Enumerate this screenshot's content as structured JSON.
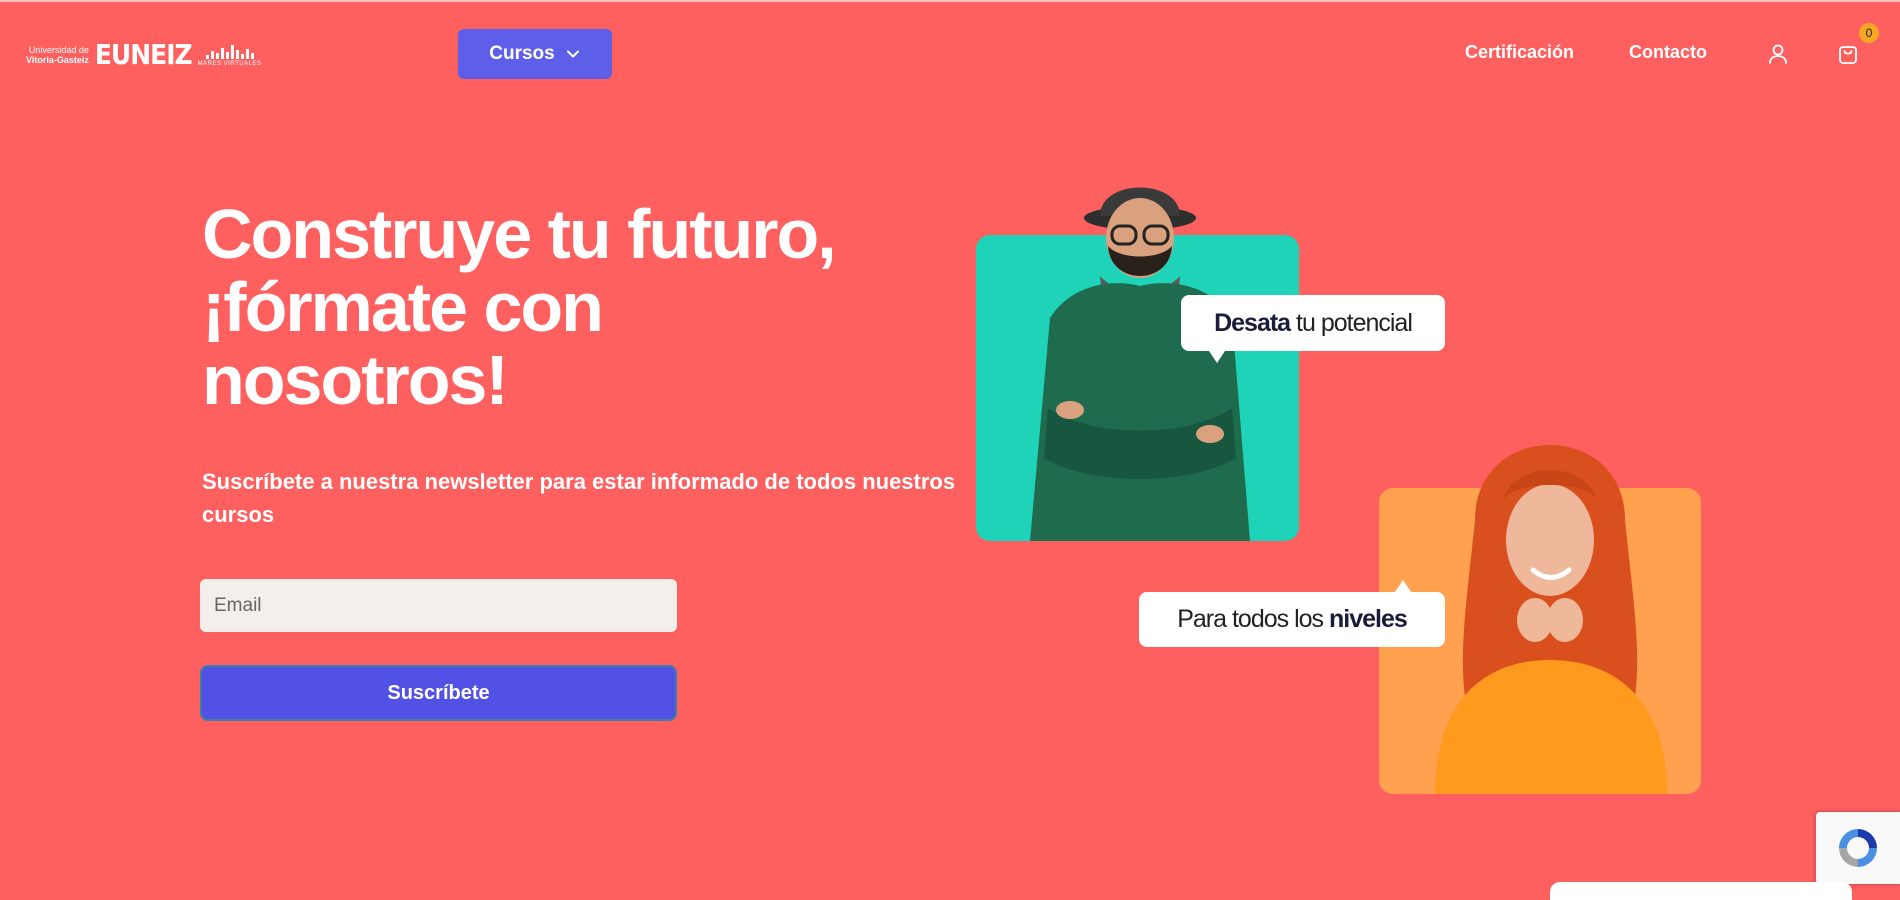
{
  "header": {
    "logo": {
      "university_line1": "Universidad de",
      "university_line2": "Vitoria-Gasteiz",
      "brand": "EUNEIZ",
      "partner": "MARES VIRTUALES"
    },
    "cursos_label": "Cursos",
    "nav": {
      "certificacion": "Certificación",
      "contacto": "Contacto"
    },
    "cart_count": "0"
  },
  "hero": {
    "title_line1": "Construye tu futuro,",
    "title_line2": "¡fórmate con",
    "title_line3": "nosotros!",
    "subtitle": "Suscríbete a nuestra newsletter para estar informado de todos nuestros cursos",
    "email_placeholder": "Email",
    "subscribe_label": "Suscríbete"
  },
  "bubbles": {
    "first_bold": "Desata",
    "first_rest": " tu potencial",
    "second_rest": "Para todos los ",
    "second_bold": "niveles"
  },
  "colors": {
    "background": "#fe5f5f",
    "primary_button": "#5151e6",
    "teal_card": "#1fd3b8",
    "orange_card": "#ffa14e",
    "badge": "#f5a623"
  },
  "icons": {
    "user": "user-icon",
    "cart": "shopping-bag-icon",
    "dropdown": "chevron-down-icon",
    "recaptcha": "recaptcha-icon"
  }
}
